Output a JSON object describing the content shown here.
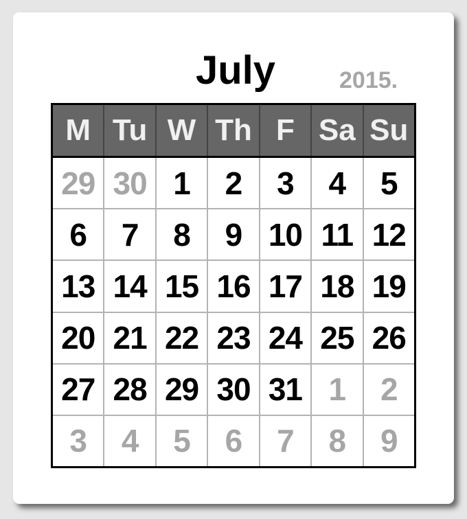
{
  "calendar": {
    "month": "July",
    "year": "2015.",
    "weekdays": [
      "M",
      "Tu",
      "W",
      "Th",
      "F",
      "Sa",
      "Su"
    ],
    "weeks": [
      [
        {
          "d": "29",
          "muted": true
        },
        {
          "d": "30",
          "muted": true
        },
        {
          "d": "1",
          "muted": false
        },
        {
          "d": "2",
          "muted": false
        },
        {
          "d": "3",
          "muted": false
        },
        {
          "d": "4",
          "muted": false
        },
        {
          "d": "5",
          "muted": false
        }
      ],
      [
        {
          "d": "6",
          "muted": false
        },
        {
          "d": "7",
          "muted": false
        },
        {
          "d": "8",
          "muted": false
        },
        {
          "d": "9",
          "muted": false
        },
        {
          "d": "10",
          "muted": false
        },
        {
          "d": "11",
          "muted": false
        },
        {
          "d": "12",
          "muted": false
        }
      ],
      [
        {
          "d": "13",
          "muted": false
        },
        {
          "d": "14",
          "muted": false
        },
        {
          "d": "15",
          "muted": false
        },
        {
          "d": "16",
          "muted": false
        },
        {
          "d": "17",
          "muted": false
        },
        {
          "d": "18",
          "muted": false
        },
        {
          "d": "19",
          "muted": false
        }
      ],
      [
        {
          "d": "20",
          "muted": false
        },
        {
          "d": "21",
          "muted": false
        },
        {
          "d": "22",
          "muted": false
        },
        {
          "d": "23",
          "muted": false
        },
        {
          "d": "24",
          "muted": false
        },
        {
          "d": "25",
          "muted": false
        },
        {
          "d": "26",
          "muted": false
        }
      ],
      [
        {
          "d": "27",
          "muted": false
        },
        {
          "d": "28",
          "muted": false
        },
        {
          "d": "29",
          "muted": false
        },
        {
          "d": "30",
          "muted": false
        },
        {
          "d": "31",
          "muted": false
        },
        {
          "d": "1",
          "muted": true
        },
        {
          "d": "2",
          "muted": true
        }
      ],
      [
        {
          "d": "3",
          "muted": true
        },
        {
          "d": "4",
          "muted": true
        },
        {
          "d": "5",
          "muted": true
        },
        {
          "d": "6",
          "muted": true
        },
        {
          "d": "7",
          "muted": true
        },
        {
          "d": "8",
          "muted": true
        },
        {
          "d": "9",
          "muted": true
        }
      ]
    ]
  },
  "colors": {
    "header_bg": "#666666",
    "header_text": "#f0f0f0",
    "day_text": "#000000",
    "muted_text": "#a6a6a6"
  }
}
